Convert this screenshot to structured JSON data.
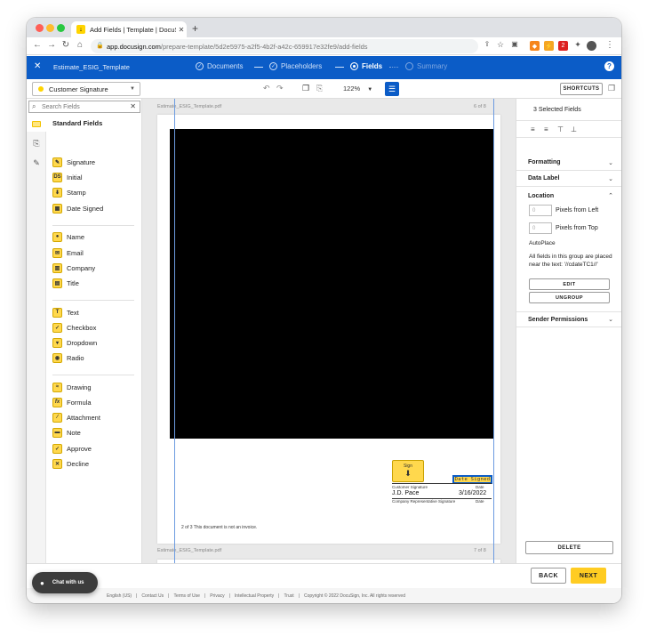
{
  "browser": {
    "tab_title": "Add Fields | Template | DocuSign",
    "new_tab": "+",
    "url_host": "app.docusign.com",
    "url_path": "/prepare-template/5d2e5975-a2f5-4b2f-a42c-659917e32fe9/add-fields",
    "ext_badge": "2"
  },
  "appbar": {
    "template_name": "Estimate_ESIG_Template",
    "steps": [
      {
        "label": "Documents",
        "state": "done"
      },
      {
        "label": "Placeholders",
        "state": "done"
      },
      {
        "label": "Fields",
        "state": "active"
      },
      {
        "label": "Summary",
        "state": "future"
      }
    ],
    "help": "?"
  },
  "toolbar": {
    "recipient": "Customer Signature",
    "zoom": "122%",
    "shortcuts": "SHORTCUTS"
  },
  "palette": {
    "search_placeholder": "Search Fields",
    "title": "Standard Fields",
    "groups": [
      [
        {
          "label": "Signature",
          "icon": "pen"
        },
        {
          "label": "Initial",
          "icon": "DS"
        },
        {
          "label": "Stamp",
          "icon": "stamp"
        },
        {
          "label": "Date Signed",
          "icon": "calendar"
        }
      ],
      [
        {
          "label": "Name",
          "icon": "person"
        },
        {
          "label": "Email",
          "icon": "envelope"
        },
        {
          "label": "Company",
          "icon": "building"
        },
        {
          "label": "Title",
          "icon": "briefcase"
        }
      ],
      [
        {
          "label": "Text",
          "icon": "T"
        },
        {
          "label": "Checkbox",
          "icon": "check"
        },
        {
          "label": "Dropdown",
          "icon": "dropdown"
        },
        {
          "label": "Radio",
          "icon": "radio"
        }
      ],
      [
        {
          "label": "Drawing",
          "icon": "drawing"
        },
        {
          "label": "Formula",
          "icon": "fx"
        },
        {
          "label": "Attachment",
          "icon": "paperclip"
        },
        {
          "label": "Note",
          "icon": "note"
        },
        {
          "label": "Approve",
          "icon": "check-circle"
        },
        {
          "label": "Decline",
          "icon": "x-circle"
        }
      ]
    ]
  },
  "document": {
    "filename": "Estimate_ESIG_Template.pdf",
    "page_top": "6 of 8",
    "page_bottom": "7 of 8",
    "sign_tag": "Sign",
    "date_tag": "Date Signed",
    "customer_sig_label": "Customer Signature",
    "date_label": "Date",
    "signer_name": "J.D. Pace",
    "signed_date": "3/16/2022",
    "company_rep_label": "Company Representative Signature",
    "date_label_2": "Date",
    "footer_note": "2 of 3 This document is not an invoice."
  },
  "rightpanel": {
    "selected_count": "3 Selected Fields",
    "sections": {
      "formatting": "Formatting",
      "data_label": "Data Label",
      "location": "Location",
      "sender_permissions": "Sender Permissions"
    },
    "px_left_value": "0",
    "px_left_label": "Pixels from Left",
    "px_top_value": "0",
    "px_top_label": "Pixels from Top",
    "autoplace": "AutoPlace",
    "group_text": "All fields in this group are placed near the text: '//cdateTC1//'",
    "edit": "EDIT",
    "ungroup": "UNGROUP",
    "delete": "DELETE"
  },
  "footer": {
    "back": "BACK",
    "next": "NEXT",
    "chat": "Chat with us",
    "legal": [
      "English (US)",
      "Contact Us",
      "Terms of Use",
      "Privacy",
      "Intellectual Property",
      "Trust",
      "Copyright © 2022 DocuSign, Inc. All rights reserved"
    ]
  },
  "colors": {
    "brand_blue": "#0b5cc7",
    "field_yellow": "#ffd84d",
    "next_yellow": "#ffcc22"
  }
}
